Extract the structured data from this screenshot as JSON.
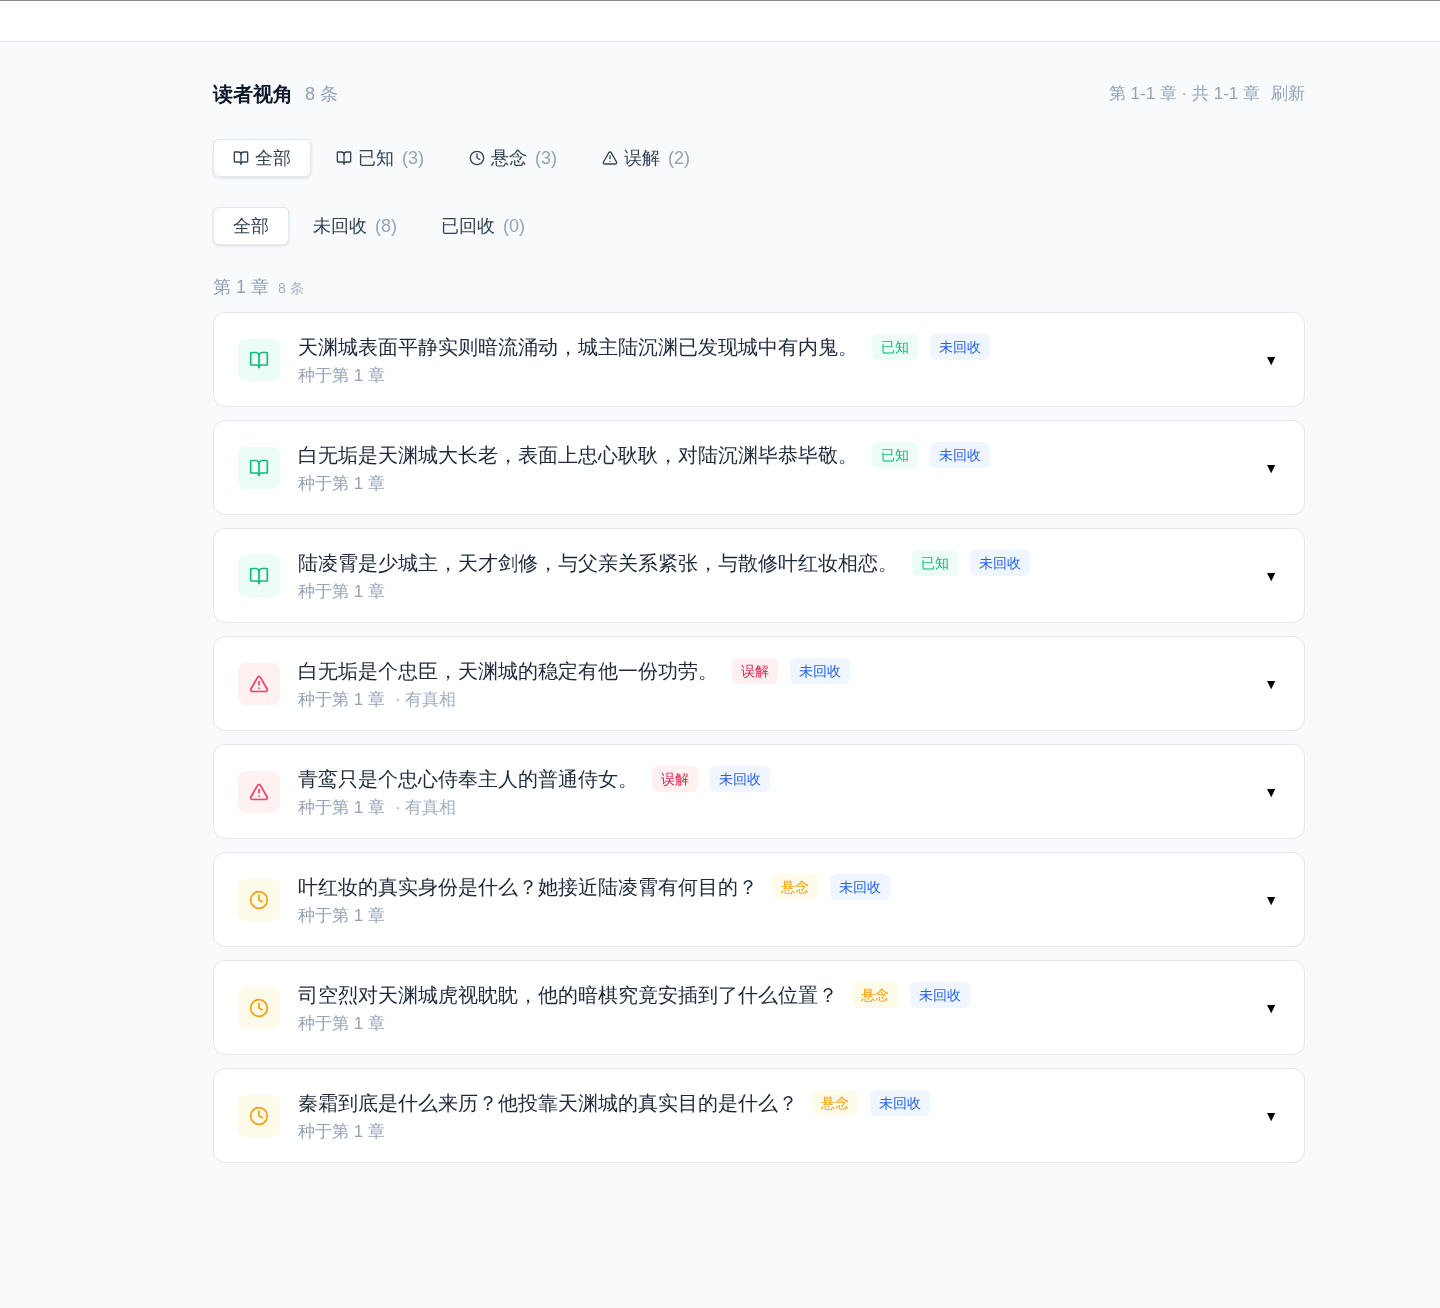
{
  "header": {
    "title": "读者视角",
    "count": "8 条",
    "range": "第 1-1 章 · 共 1-1 章",
    "refresh": "刷新"
  },
  "type_tabs": [
    {
      "kind": "all",
      "label": "全部",
      "selected": true
    },
    {
      "kind": "known",
      "label": "已知",
      "count": "(3)",
      "selected": false
    },
    {
      "kind": "suspense",
      "label": "悬念",
      "count": "(3)",
      "selected": false
    },
    {
      "kind": "misread",
      "label": "误解",
      "count": "(2)",
      "selected": false
    }
  ],
  "status_tabs": [
    {
      "label": "全部",
      "selected": true
    },
    {
      "label": "未回收",
      "count": "(8)",
      "selected": false
    },
    {
      "label": "已回收",
      "count": "(0)",
      "selected": false
    }
  ],
  "chapter": {
    "title": "第 1 章",
    "count": "8 条"
  },
  "items": [
    {
      "kind": "known",
      "text": "天渊城表面平静实则暗流涌动，城主陆沉渊已发现城中有内鬼。",
      "tags": [
        {
          "kind": "known",
          "label": "已知"
        },
        {
          "kind": "open",
          "label": "未回收"
        }
      ],
      "origin": "种于第 1 章",
      "toggle": "▼"
    },
    {
      "kind": "known",
      "text": "白无垢是天渊城大长老，表面上忠心耿耿，对陆沉渊毕恭毕敬。",
      "tags": [
        {
          "kind": "known",
          "label": "已知"
        },
        {
          "kind": "open",
          "label": "未回收"
        }
      ],
      "origin": "种于第 1 章",
      "toggle": "▼"
    },
    {
      "kind": "known",
      "text": "陆凌霄是少城主，天才剑修，与父亲关系紧张，与散修叶红妆相恋。",
      "tags": [
        {
          "kind": "known",
          "label": "已知"
        },
        {
          "kind": "open",
          "label": "未回收"
        }
      ],
      "origin": "种于第 1 章",
      "toggle": "▼"
    },
    {
      "kind": "misread",
      "text": "白无垢是个忠臣，天渊城的稳定有他一份功劳。",
      "tags": [
        {
          "kind": "misread",
          "label": "误解"
        },
        {
          "kind": "open",
          "label": "未回收"
        }
      ],
      "origin": "种于第 1 章",
      "note": "· 有真相",
      "toggle": "▼"
    },
    {
      "kind": "misread",
      "text": "青鸾只是个忠心侍奉主人的普通侍女。",
      "tags": [
        {
          "kind": "misread",
          "label": "误解"
        },
        {
          "kind": "open",
          "label": "未回收"
        }
      ],
      "origin": "种于第 1 章",
      "note": "· 有真相",
      "toggle": "▼"
    },
    {
      "kind": "suspense",
      "text": "叶红妆的真实身份是什么？她接近陆凌霄有何目的？",
      "tags": [
        {
          "kind": "suspense",
          "label": "悬念"
        },
        {
          "kind": "open",
          "label": "未回收"
        }
      ],
      "origin": "种于第 1 章",
      "toggle": "▼"
    },
    {
      "kind": "suspense",
      "text": "司空烈对天渊城虎视眈眈，他的暗棋究竟安插到了什么位置？",
      "tags": [
        {
          "kind": "suspense",
          "label": "悬念"
        },
        {
          "kind": "open",
          "label": "未回收"
        }
      ],
      "origin": "种于第 1 章",
      "toggle": "▼"
    },
    {
      "kind": "suspense",
      "text": "秦霜到底是什么来历？他投靠天渊城的真实目的是什么？",
      "tags": [
        {
          "kind": "suspense",
          "label": "悬念"
        },
        {
          "kind": "open",
          "label": "未回收"
        }
      ],
      "origin": "种于第 1 章",
      "toggle": "▼"
    }
  ]
}
